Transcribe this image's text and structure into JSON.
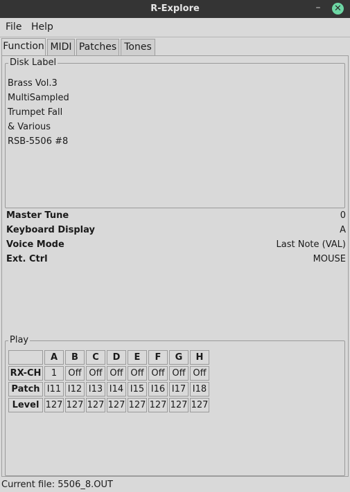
{
  "window": {
    "title": "R-Explore",
    "minimize_glyph": "–",
    "close_glyph": "✕"
  },
  "menu": {
    "file": "File",
    "help": "Help"
  },
  "tabs": [
    "Function",
    "MIDI",
    "Patches",
    "Tones"
  ],
  "disk_label": {
    "title": "Disk Label",
    "lines": [
      "Brass Vol.3",
      "MultiSampled",
      "Trumpet Fall",
      "& Various",
      "RSB-5506 #8"
    ]
  },
  "params": [
    {
      "label": "Master Tune",
      "value": "0"
    },
    {
      "label": "Keyboard Display",
      "value": "A"
    },
    {
      "label": "Voice Mode",
      "value": "Last Note (VAL)"
    },
    {
      "label": "Ext. Ctrl",
      "value": "MOUSE"
    }
  ],
  "play": {
    "title": "Play",
    "columns": [
      "A",
      "B",
      "C",
      "D",
      "E",
      "F",
      "G",
      "H"
    ],
    "rows": [
      {
        "label": "RX-CH",
        "values": [
          "1",
          "Off",
          "Off",
          "Off",
          "Off",
          "Off",
          "Off",
          "Off"
        ]
      },
      {
        "label": "Patch",
        "values": [
          "I11",
          "I12",
          "I13",
          "I14",
          "I15",
          "I16",
          "I17",
          "I18"
        ]
      },
      {
        "label": "Level",
        "values": [
          "127",
          "127",
          "127",
          "127",
          "127",
          "127",
          "127",
          "127"
        ]
      }
    ]
  },
  "status": {
    "text": "Current file: 5506_8.OUT"
  }
}
